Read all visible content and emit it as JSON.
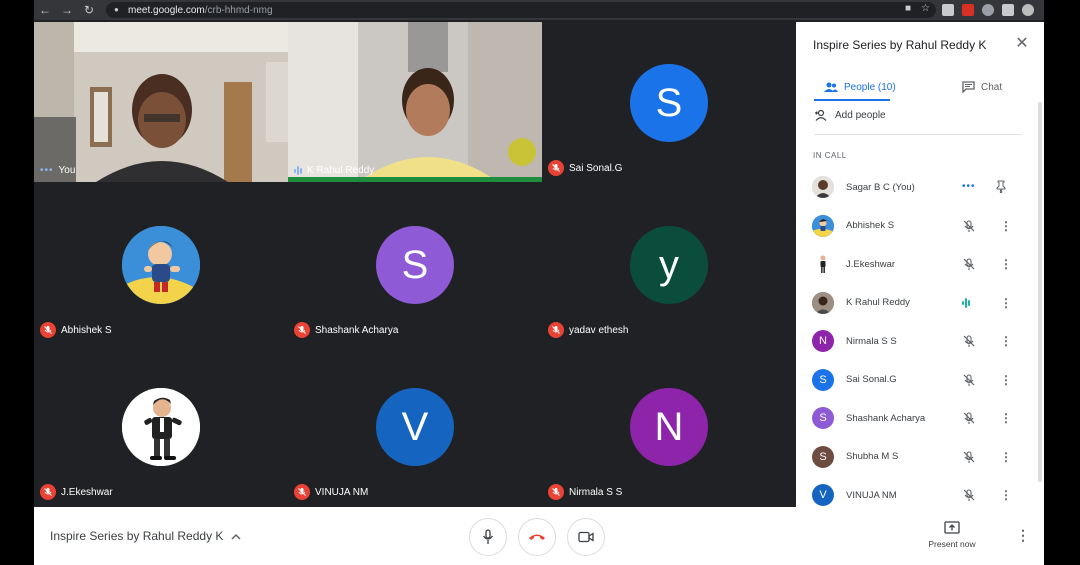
{
  "browser": {
    "url_host": "meet.google.com",
    "url_path": "/crb-hhmd-nmg"
  },
  "tiles": [
    {
      "name": "You",
      "status": "dots"
    },
    {
      "name": "K Rahul Reddy",
      "status": "speaking"
    },
    {
      "name": "Sai Sonal.G",
      "status": "muted",
      "initial": "S",
      "color": "#1a73e8"
    },
    {
      "name": "Abhishek S",
      "status": "muted"
    },
    {
      "name": "Shashank Acharya",
      "status": "muted",
      "initial": "S",
      "color": "#8e5ad6"
    },
    {
      "name": "yadav ethesh",
      "status": "muted",
      "initial": "y",
      "color": "#0b4d3c"
    },
    {
      "name": "J.Ekeshwar",
      "status": "muted"
    },
    {
      "name": "VINUJA NM",
      "status": "muted",
      "initial": "V",
      "color": "#1565c0"
    },
    {
      "name": "Nirmala S S",
      "status": "muted",
      "initial": "N",
      "color": "#8e24aa"
    }
  ],
  "panel": {
    "title": "Inspire Series by Rahul Reddy K",
    "people_tab": "People (10)",
    "chat_tab": "Chat",
    "add_people": "Add people",
    "section": "IN CALL",
    "participants": [
      {
        "name": "Sagar B C (You)",
        "status": "dots"
      },
      {
        "name": "Abhishek S",
        "status": "muted"
      },
      {
        "name": "J.Ekeshwar",
        "status": "muted"
      },
      {
        "name": "K Rahul Reddy",
        "status": "speaking"
      },
      {
        "name": "Nirmala S S",
        "status": "muted",
        "initial": "N",
        "color": "#8e24aa"
      },
      {
        "name": "Sai Sonal.G",
        "status": "muted",
        "initial": "S",
        "color": "#1a73e8"
      },
      {
        "name": "Shashank Acharya",
        "status": "muted",
        "initial": "S",
        "color": "#8e5ad6"
      },
      {
        "name": "Shubha M S",
        "status": "muted",
        "initial": "S",
        "color": "#6d4c41"
      },
      {
        "name": "VINUJA NM",
        "status": "muted",
        "initial": "V",
        "color": "#1565c0"
      }
    ]
  },
  "bottom": {
    "meeting_title": "Inspire Series by Rahul Reddy K",
    "present_now": "Present now"
  },
  "colors": {
    "accent": "#1a73e8",
    "hangup": "#ea4335",
    "muted": "#ea4335"
  }
}
